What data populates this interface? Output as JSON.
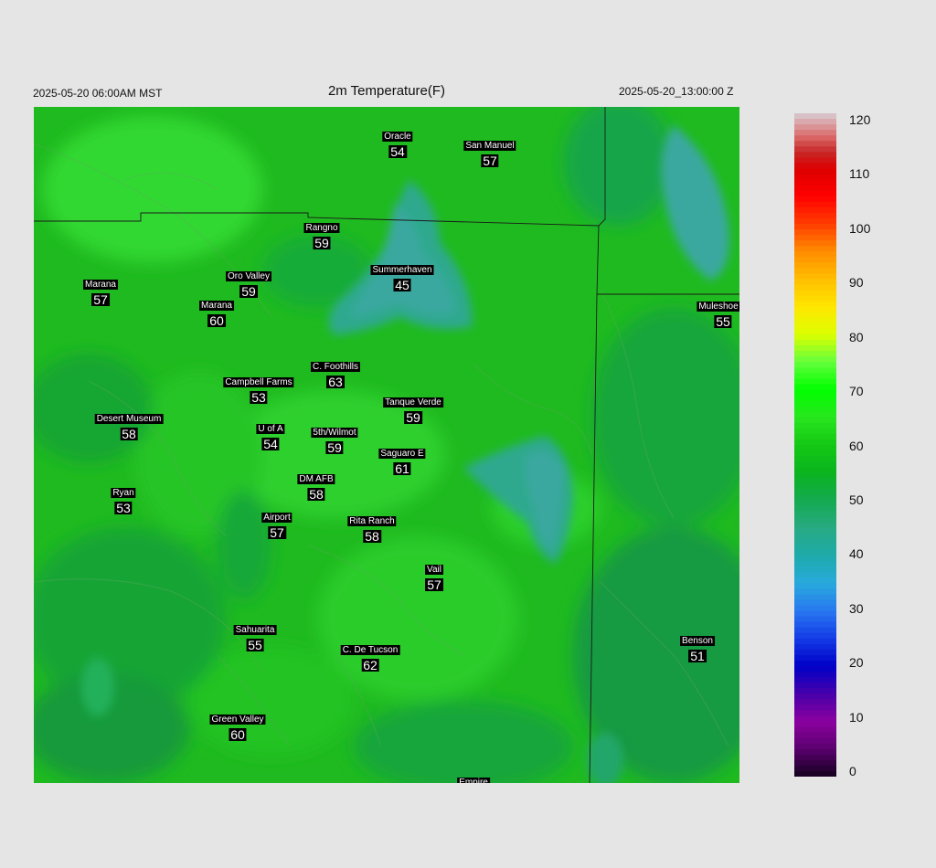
{
  "header": {
    "local_time": "2025-05-20 06:00AM MST",
    "title": "2m Temperature(F)",
    "utc_time": "2025-05-20_13:00:00 Z"
  },
  "stations": [
    {
      "name": "Oracle",
      "value": "54"
    },
    {
      "name": "San Manuel",
      "value": "57"
    },
    {
      "name": "Rangno",
      "value": "59"
    },
    {
      "name": "Summerhaven",
      "value": "45"
    },
    {
      "name": "Marana",
      "value": "57"
    },
    {
      "name": "Oro Valley",
      "value": "59"
    },
    {
      "name": "Marana",
      "value": "60"
    },
    {
      "name": "Muleshoe R",
      "value": "55"
    },
    {
      "name": "C. Foothills",
      "value": "63"
    },
    {
      "name": "Campbell Farms",
      "value": "53"
    },
    {
      "name": "Tanque Verde",
      "value": "59"
    },
    {
      "name": "Desert Museum",
      "value": "58"
    },
    {
      "name": "U of A",
      "value": "54"
    },
    {
      "name": "5th/Wilmot",
      "value": "59"
    },
    {
      "name": "Saguaro E",
      "value": "61"
    },
    {
      "name": "DM AFB",
      "value": "58"
    },
    {
      "name": "Ryan",
      "value": "53"
    },
    {
      "name": "Airport",
      "value": "57"
    },
    {
      "name": "Rita Ranch",
      "value": "58"
    },
    {
      "name": "Vail",
      "value": "57"
    },
    {
      "name": "Sahuarita",
      "value": "55"
    },
    {
      "name": "C. De Tucson",
      "value": "62"
    },
    {
      "name": "Benson",
      "value": "51"
    },
    {
      "name": "Green Valley",
      "value": "60"
    },
    {
      "name": "Empire",
      "value": ""
    }
  ],
  "colorbar": {
    "ticks": [
      "120",
      "110",
      "100",
      "90",
      "80",
      "70",
      "60",
      "50",
      "40",
      "30",
      "20",
      "10",
      "0"
    ],
    "min": 0,
    "max": 120
  }
}
